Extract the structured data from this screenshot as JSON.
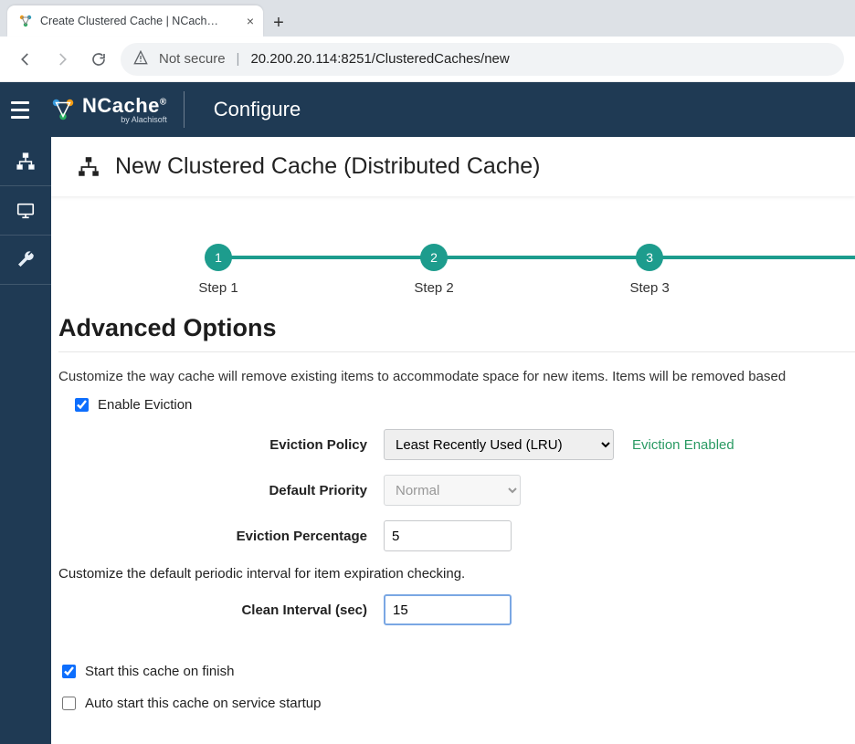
{
  "browser": {
    "tab_title": "Create Clustered Cache | NCach…",
    "secure_label": "Not secure",
    "url": "20.200.20.114:8251/ClusteredCaches/new"
  },
  "brand": {
    "name": "NCache",
    "sub": "by Alachisoft"
  },
  "header": {
    "title": "Configure"
  },
  "page": {
    "title": "New Clustered Cache (Distributed Cache)"
  },
  "stepper": {
    "steps": [
      {
        "num": "1",
        "label": "Step 1"
      },
      {
        "num": "2",
        "label": "Step 2"
      },
      {
        "num": "3",
        "label": "Step 3"
      }
    ]
  },
  "section": {
    "title": "Advanced Options"
  },
  "text": {
    "desc1": "Customize the way cache will remove existing items to accommodate space for new items. Items will be removed based",
    "desc2": "Customize the default periodic interval for item expiration checking."
  },
  "eviction": {
    "enable_label": "Enable Eviction",
    "enable_checked": true,
    "policy_label": "Eviction Policy",
    "policy_value": "Least Recently Used (LRU)",
    "status": "Eviction Enabled",
    "priority_label": "Default Priority",
    "priority_value": "Normal",
    "percentage_label": "Eviction Percentage",
    "percentage_value": "5"
  },
  "clean": {
    "label": "Clean Interval (sec)",
    "value": "15"
  },
  "footer": {
    "start_label": "Start this cache on finish",
    "start_checked": true,
    "auto_label": "Auto start this cache on service startup",
    "auto_checked": false
  }
}
